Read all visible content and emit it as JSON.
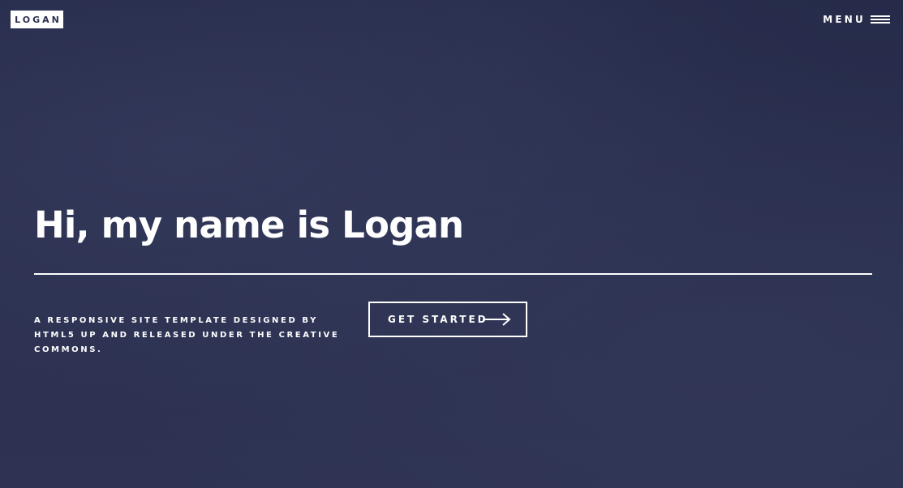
{
  "header": {
    "logo_text": "LOGAN",
    "menu_label": "MENU"
  },
  "banner": {
    "headline": "Hi, my name is Logan",
    "tagline": "A RESPONSIVE SITE TEMPLATE DESIGNED BY HTML5 UP AND RELEASED UNDER THE CREATIVE COMMONS.",
    "cta_label": "GET STARTED"
  },
  "icons": {
    "menu": "hamburger-icon",
    "cta": "arrow-right-icon"
  },
  "colors": {
    "background": "#2a2f4f",
    "foreground": "#ffffff"
  }
}
